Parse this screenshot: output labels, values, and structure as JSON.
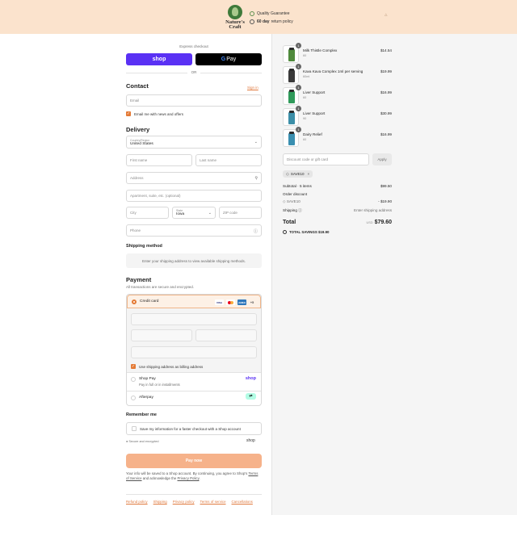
{
  "header": {
    "brand_line1": "Nature's",
    "brand_line2": "Craft",
    "guarantee_text": "Quality Guarantee",
    "return_bold": "60 day",
    "return_text": "return policy"
  },
  "express": {
    "label": "Express checkout",
    "shop_label": "shop",
    "gpay_g": "G",
    "gpay_label": "Pay",
    "or_label": "OR"
  },
  "contact": {
    "title": "Contact",
    "sign_in": "Sign in",
    "email_placeholder": "Email",
    "news_label": "Email me with news and offers"
  },
  "delivery": {
    "title": "Delivery",
    "country_label": "Country/Region",
    "country_value": "United States",
    "first_name": "First name",
    "last_name": "Last name",
    "address": "Address",
    "apartment": "Apartment, suite, etc. (optional)",
    "city": "City",
    "state_label": "State",
    "state_value": "Iowa",
    "zip": "ZIP code",
    "phone": "Phone"
  },
  "shipping": {
    "title": "Shipping method",
    "note": "Enter your shipping address to view available shipping methods."
  },
  "payment": {
    "title": "Payment",
    "subtitle": "All transactions are secure and encrypted.",
    "credit_card_label": "Credit card",
    "card_visa": "VISA",
    "card_amex": "AMEX",
    "card_more": "+5",
    "billing_label": "Use shipping address as billing address",
    "shop_pay_label": "Shop Pay",
    "shop_pay_sub": "Pay in full or in installments",
    "shop_pay_logo": "shop",
    "afterpay_label": "Afterpay"
  },
  "remember": {
    "title": "Remember me",
    "save_label": "Save my information for a faster checkout with a Shop account",
    "secure_label": "Secure and encrypted",
    "shop_logo": "shop"
  },
  "pay_now_label": "Pay now",
  "legal": {
    "text1": "Your info will be saved to a Shop account. By continuing, you agree to Shop's",
    "terms_link": "Terms of Service",
    "text2": "and acknowledge the",
    "privacy_link": "Privacy Policy",
    "period": "."
  },
  "footer_links": [
    "Refund policy",
    "Shipping",
    "Privacy policy",
    "Terms of service",
    "Cancellations"
  ],
  "summary": {
    "items": [
      {
        "name": "Milk Thistle Complex",
        "variant": "60",
        "price": "$14.54",
        "qty": "1",
        "color": "#4f8a3c"
      },
      {
        "name": "Kava Kava Complex 1ml per serving",
        "variant": "60ml",
        "price": "$19.99",
        "qty": "1",
        "color": "#3a3a3a"
      },
      {
        "name": "Liver Support",
        "variant": "60",
        "price": "$16.99",
        "qty": "1",
        "color": "#2f9a5a"
      },
      {
        "name": "Liver Support",
        "variant": "90",
        "price": "$30.99",
        "qty": "1",
        "color": "#3c8fa8"
      },
      {
        "name": "Dairy Relief",
        "variant": "60",
        "price": "$16.99",
        "qty": "1",
        "color": "#3a8fb0"
      }
    ],
    "discount_placeholder": "Discount code or gift card",
    "apply_label": "Apply",
    "discount_tag": "SAVE10",
    "subtotal_label": "Subtotal · 5 items",
    "subtotal_value": "$99.50",
    "order_discount_label": "Order discount",
    "discount_code": "SAVE10",
    "discount_value": "- $19.90",
    "shipping_label": "Shipping",
    "shipping_value": "Enter shipping address",
    "total_label": "Total",
    "currency": "USD",
    "total_value": "$79.60",
    "savings_label": "TOTAL SAVINGS",
    "savings_value": "$19.90"
  }
}
